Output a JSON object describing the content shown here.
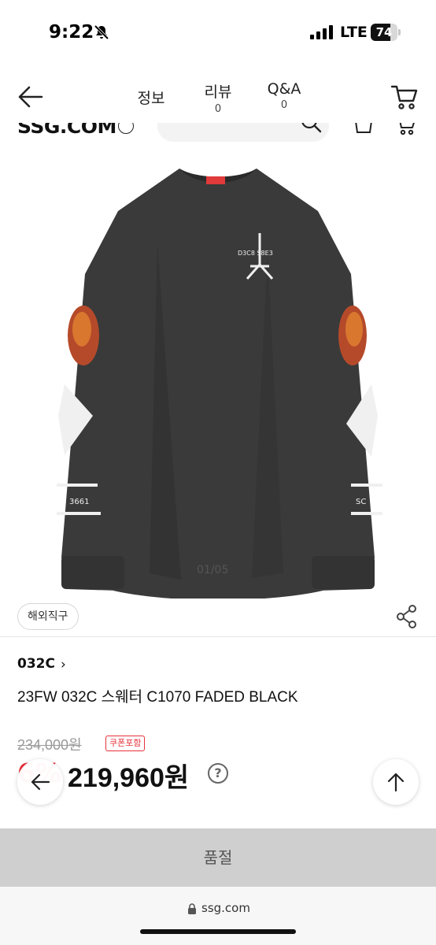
{
  "status_bar": {
    "time": "9:22",
    "network": "LTE",
    "battery": "74",
    "battery_fraction": 0.74
  },
  "nav": {
    "tabs": [
      {
        "label": "정보"
      },
      {
        "label": "리뷰",
        "count": "0"
      },
      {
        "label": "Q&A",
        "count": "0"
      }
    ]
  },
  "header": {
    "logo": "SSG.COM"
  },
  "product": {
    "image_counter": "01/05",
    "badge": "해외직구",
    "brand": "032C",
    "name": "23FW 032C 스웨터 C1070 FADED BLACK",
    "original_price": "234,000원",
    "coupon_badge": "쿠폰포함",
    "discount_rate": "6%",
    "sale_price": "219,960원",
    "shirt_colors": {
      "body": "#3a3a3a",
      "body_shadow": "#2f2f2f",
      "collar_tag": "#e03a3a",
      "print": "#f0f0f0"
    }
  },
  "actions": {
    "soldout_label": "품절"
  },
  "browser": {
    "url": "ssg.com"
  },
  "icons": {
    "bell": "bell-slash-icon",
    "signal": "signal-bars-icon",
    "back": "arrow-left-icon",
    "cart": "cart-icon",
    "search": "search-icon",
    "bag": "shopping-bag-icon",
    "share": "share-icon",
    "help": "question-icon",
    "top": "arrow-up-icon",
    "lock": "lock-icon"
  }
}
